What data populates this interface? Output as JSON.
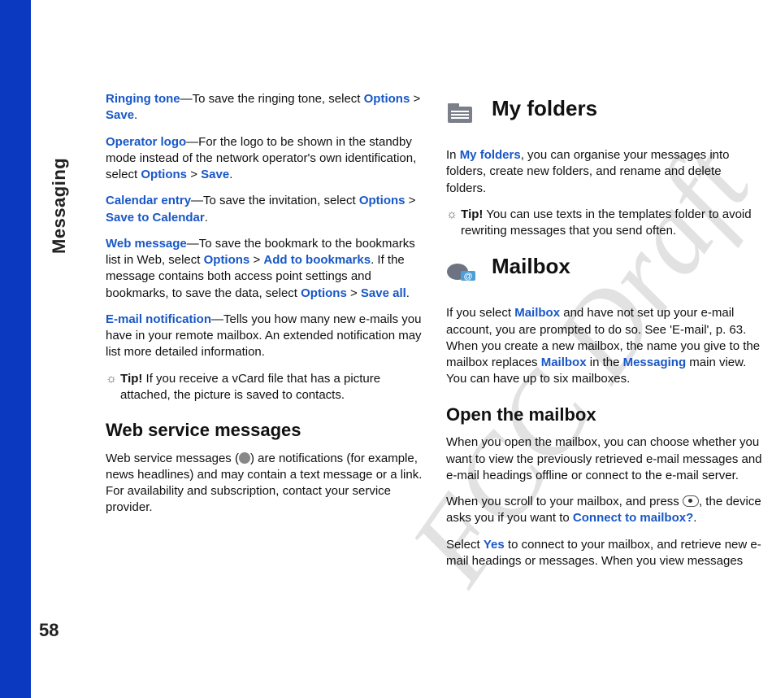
{
  "sidebar": {
    "section": "Messaging",
    "page_number": "58"
  },
  "watermark": "FCC Draft",
  "col1": {
    "p1": {
      "b1": "Ringing tone",
      "t1": "—To save the ringing tone, select ",
      "b2": "Options",
      "t2": " > ",
      "b3": "Save",
      "t3": "."
    },
    "p2": {
      "b1": "Operator logo",
      "t1": "—For the logo to be shown in the standby mode instead of the network operator's own identification, select ",
      "b2": "Options",
      "t2": " > ",
      "b3": "Save",
      "t3": "."
    },
    "p3": {
      "b1": "Calendar entry",
      "t1": "—To save the invitation, select ",
      "b2": "Options",
      "t2": " > ",
      "b3": "Save to Calendar",
      "t3": "."
    },
    "p4": {
      "b1": "Web message",
      "t1": "—To save the bookmark to the bookmarks list in Web, select ",
      "b2": "Options",
      "t2": " > ",
      "b3": "Add to bookmarks",
      "t3": ". If the message contains both access point settings and bookmarks, to save the data, select ",
      "b4": "Options",
      "t4": " > ",
      "b5": "Save all",
      "t5": "."
    },
    "p5": {
      "b1": "E-mail notification",
      "t1": "—Tells you how many new e-mails you have in your remote mailbox. An extended notification may list more detailed information."
    },
    "tip1": {
      "label": "Tip!",
      "text": " If you receive a vCard file that has a picture attached, the picture is saved to contacts."
    },
    "h_web": "Web service messages",
    "p6a": "Web service messages (",
    "p6b": ") are notifications (for example, news headlines) and may contain a text message or a link. For availability and subscription, contact your service provider."
  },
  "col2": {
    "h_myfolders": "My folders",
    "p1": {
      "t0": "In ",
      "b1": "My folders",
      "t1": ", you can organise your messages into folders, create new folders, and rename and delete folders."
    },
    "tip1": {
      "label": "Tip!",
      "text": " You can use texts in the templates folder to avoid rewriting messages that you send often."
    },
    "h_mailbox": "Mailbox",
    "p2": {
      "t0": "If you select ",
      "b1": "Mailbox",
      "t1": " and have not set up your e-mail account, you are prompted to do so. See 'E-mail', p. 63. When you create a new mailbox, the name you give to the mailbox replaces ",
      "b2": "Mailbox",
      "t2": " in the ",
      "b3": "Messaging",
      "t3": " main view. You can have up to six mailboxes."
    },
    "h_open": "Open the mailbox",
    "p3": "When you open the mailbox, you can choose whether you want to view the previously retrieved e-mail messages and e-mail headings offline or connect to the e-mail server.",
    "p4": {
      "t0": "When you scroll to your mailbox, and press ",
      "t1": ", the device asks you if you want to ",
      "b1": "Connect to mailbox?",
      "t2": "."
    },
    "p5": {
      "t0": "Select ",
      "b1": "Yes",
      "t1": " to connect to your mailbox, and retrieve new e-mail headings or messages. When you view messages"
    }
  }
}
